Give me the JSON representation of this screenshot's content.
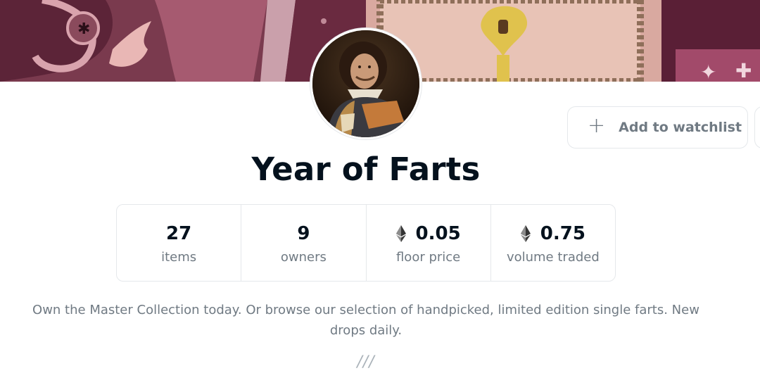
{
  "collection": {
    "title": "Year of Farts",
    "description": "Own the Master Collection today. Or browse our selection of handpicked, limited edition single farts. New drops daily.",
    "divider": "///"
  },
  "actions": {
    "watchlist_icon": "plus-icon",
    "watchlist_label": "Add to watchlist"
  },
  "stats": [
    {
      "value": "27",
      "label": "items",
      "currency": ""
    },
    {
      "value": "9",
      "label": "owners",
      "currency": ""
    },
    {
      "value": "0.05",
      "label": "floor price",
      "currency": "ethereum-icon"
    },
    {
      "value": "0.75",
      "label": "volume traded",
      "currency": "ethereum-icon"
    }
  ],
  "colors": {
    "banner": "#7a3a4e",
    "text_primary": "#04111d",
    "text_secondary": "#707a83",
    "border": "#e5e8eb"
  }
}
